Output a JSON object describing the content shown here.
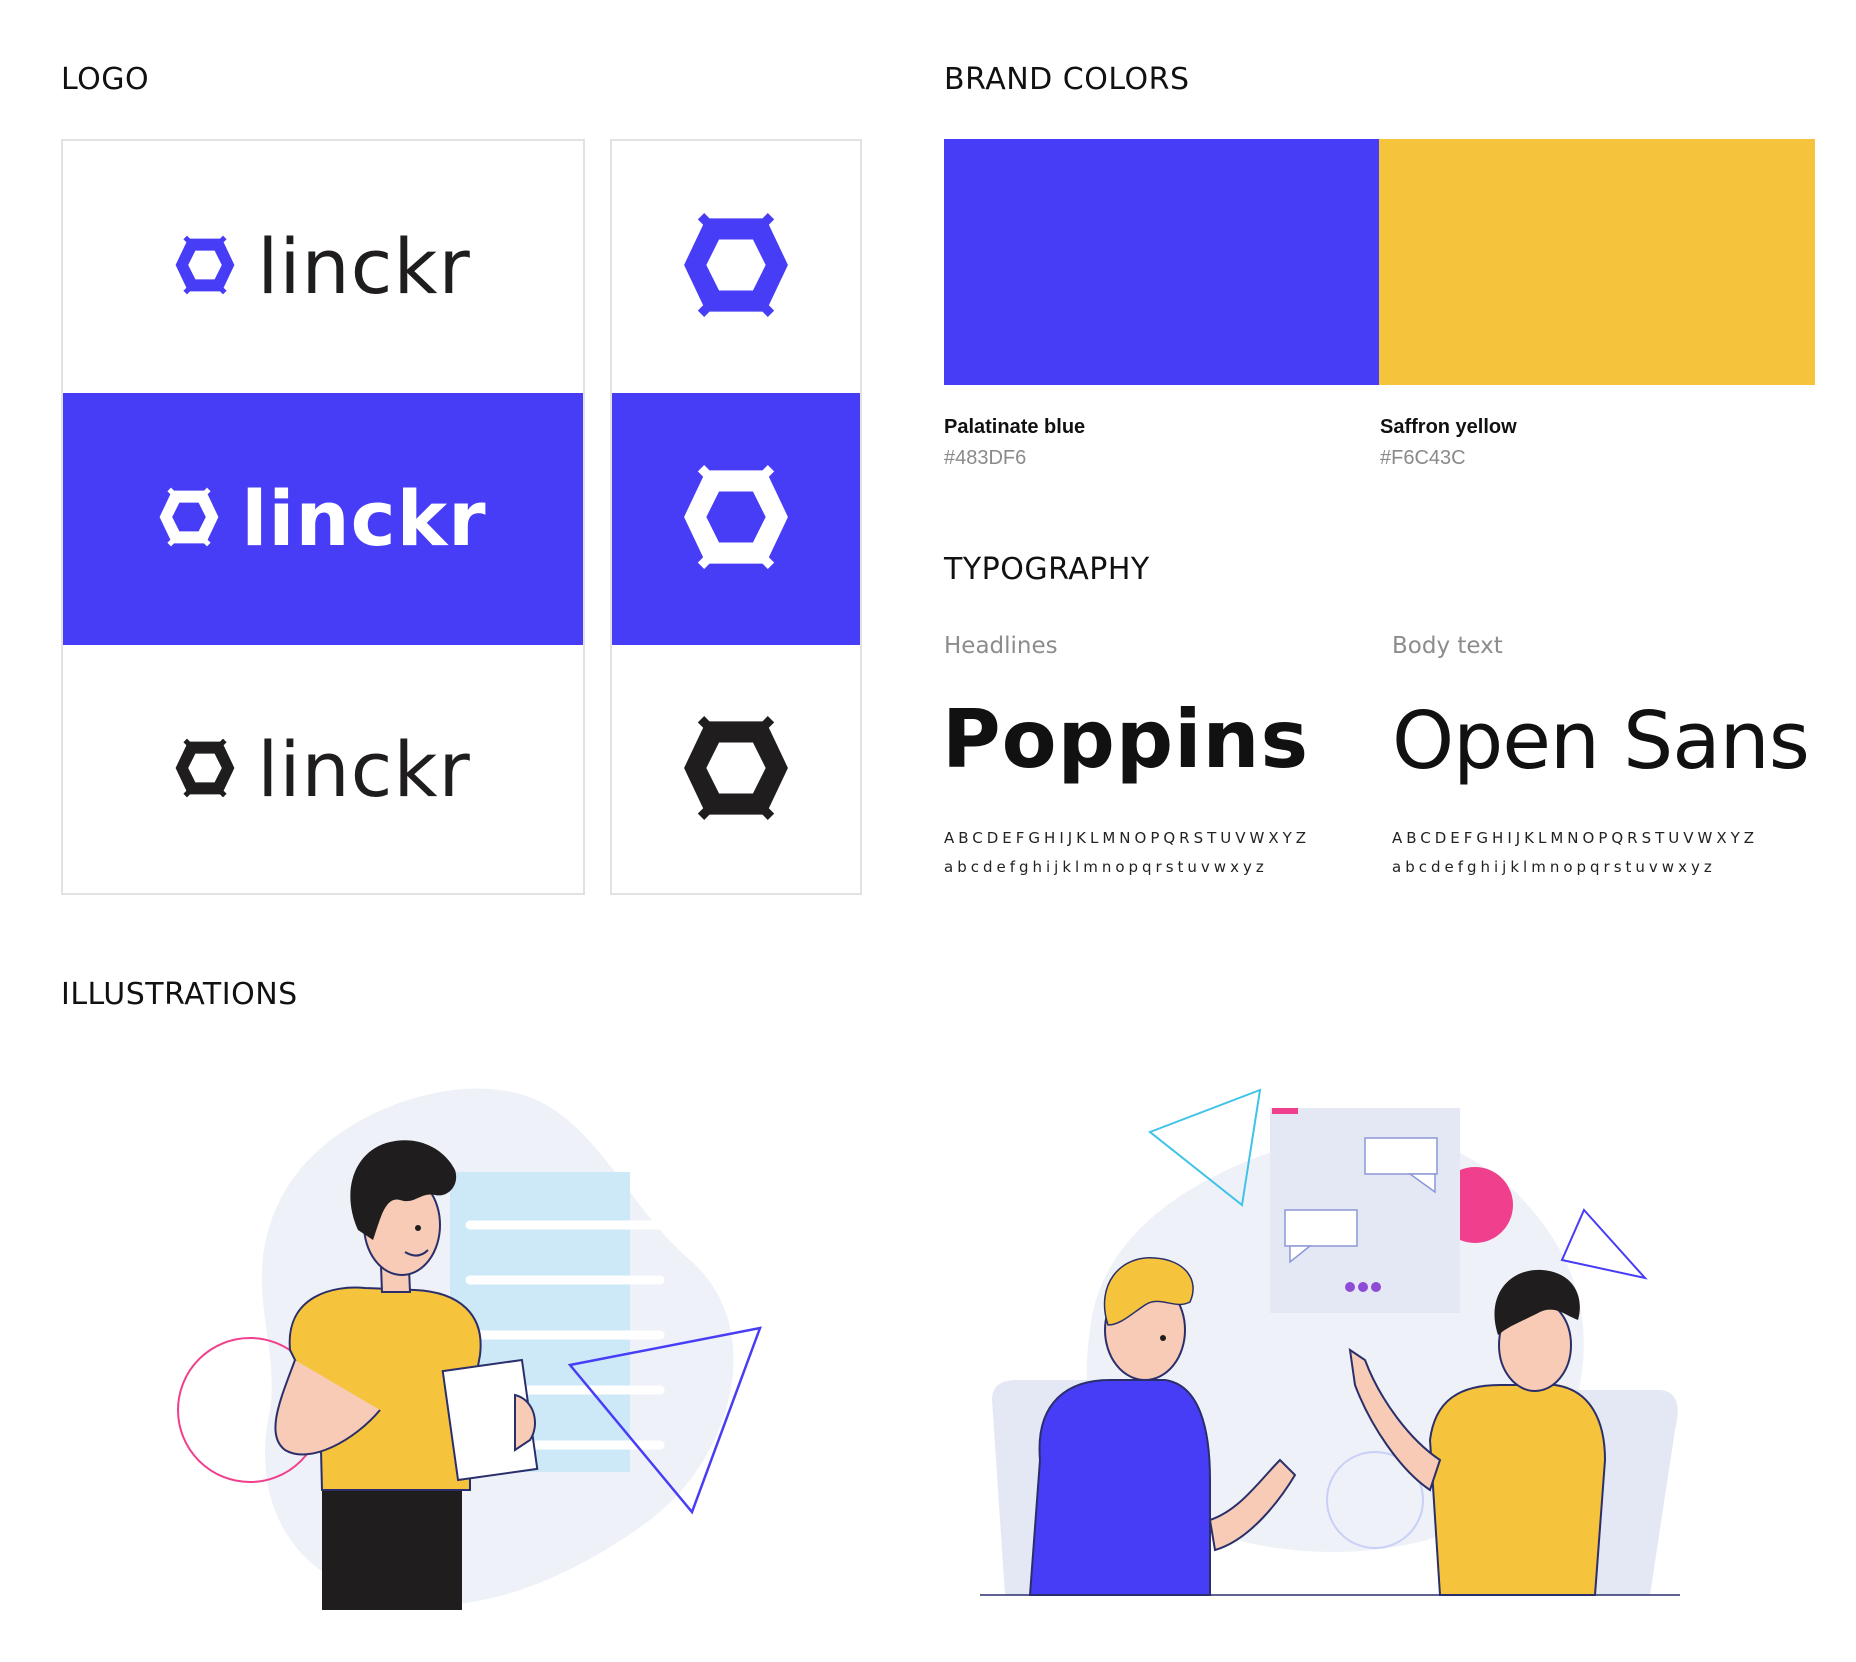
{
  "colors": {
    "primary": "#483DF6",
    "secondary": "#F6C43C",
    "dark": "#1F1D1E",
    "pink": "#F03F8C",
    "skin": "#F7CBB6",
    "line": "#2A2F6B",
    "bg_blob": "#EEF2F8"
  },
  "sections": {
    "logo_title": "LOGO",
    "brand_colors_title": "BRAND COLORS",
    "typography_title": "TYPOGRAPHY",
    "illustrations_title": "ILLUSTRATIONS"
  },
  "logo": {
    "wordmark": "linckr",
    "icon": "hexagon-logo-icon",
    "variants": [
      "color-on-white",
      "white-on-blue",
      "black-on-white"
    ]
  },
  "brand_colors": [
    {
      "name": "Palatinate blue",
      "hex": "#483DF6"
    },
    {
      "name": "Saffron yellow",
      "hex": "#F6C43C"
    }
  ],
  "typography": {
    "headlines": {
      "label": "Headlines",
      "font": "Poppins",
      "uppercase": "ABCDEFGHIJKLMNOPQRSTUVWXYZ",
      "lowercase": "abcdefghijklmnopqrstuvwxyz"
    },
    "body": {
      "label": "Body text",
      "font": "Open Sans",
      "uppercase": "ABCDEFGHIJKLMNOPQRSTUVWXYZ",
      "lowercase": "abcdefghijklmnopqrstuvwxyz"
    }
  },
  "illustrations": [
    "person-holding-document-illustration",
    "two-people-chatting-illustration"
  ]
}
